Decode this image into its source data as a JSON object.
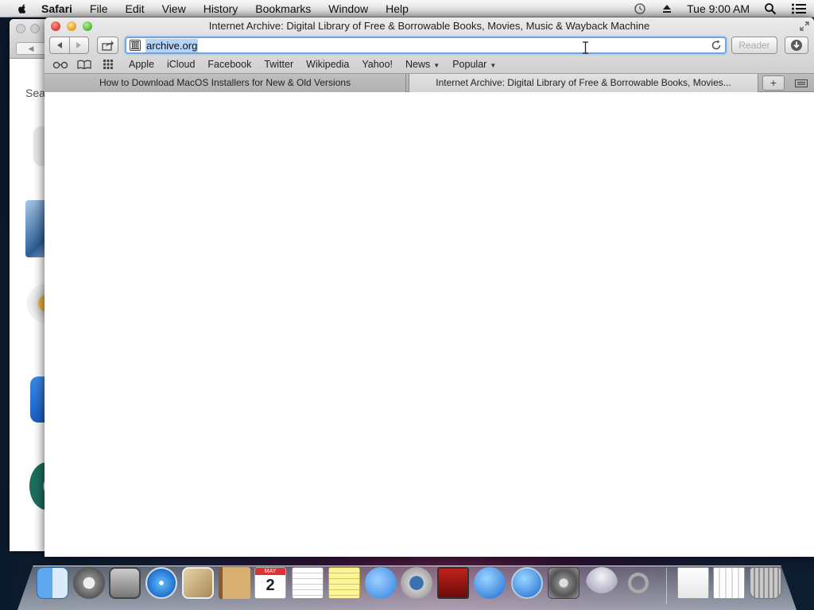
{
  "menubar": {
    "app_name": "Safari",
    "items": [
      "File",
      "Edit",
      "View",
      "History",
      "Bookmarks",
      "Window",
      "Help"
    ],
    "clock": "Tue 9:00 AM"
  },
  "background_window": {
    "partial_text": "Sea"
  },
  "window": {
    "title": "Internet Archive: Digital Library of Free & Borrowable Books, Movies, Music & Wayback Machine",
    "url": "archive.org",
    "reader_label": "Reader"
  },
  "bookmarks": {
    "items": [
      {
        "label": "Apple"
      },
      {
        "label": "iCloud"
      },
      {
        "label": "Facebook"
      },
      {
        "label": "Twitter"
      },
      {
        "label": "Wikipedia"
      },
      {
        "label": "Yahoo!"
      },
      {
        "label": "News"
      },
      {
        "label": "Popular"
      }
    ]
  },
  "tabs": [
    {
      "label": "How to Download MacOS Installers for New & Old Versions",
      "active": false
    },
    {
      "label": "Internet Archive: Digital Library of Free & Borrowable Books, Movies...",
      "active": true
    }
  ],
  "new_tab_label": "+",
  "dock": {
    "calendar_day": "2",
    "calendar_month": "MAY"
  },
  "colors": {
    "url_focus": "#6fa5e0",
    "url_selection": "#b4d3f7"
  }
}
